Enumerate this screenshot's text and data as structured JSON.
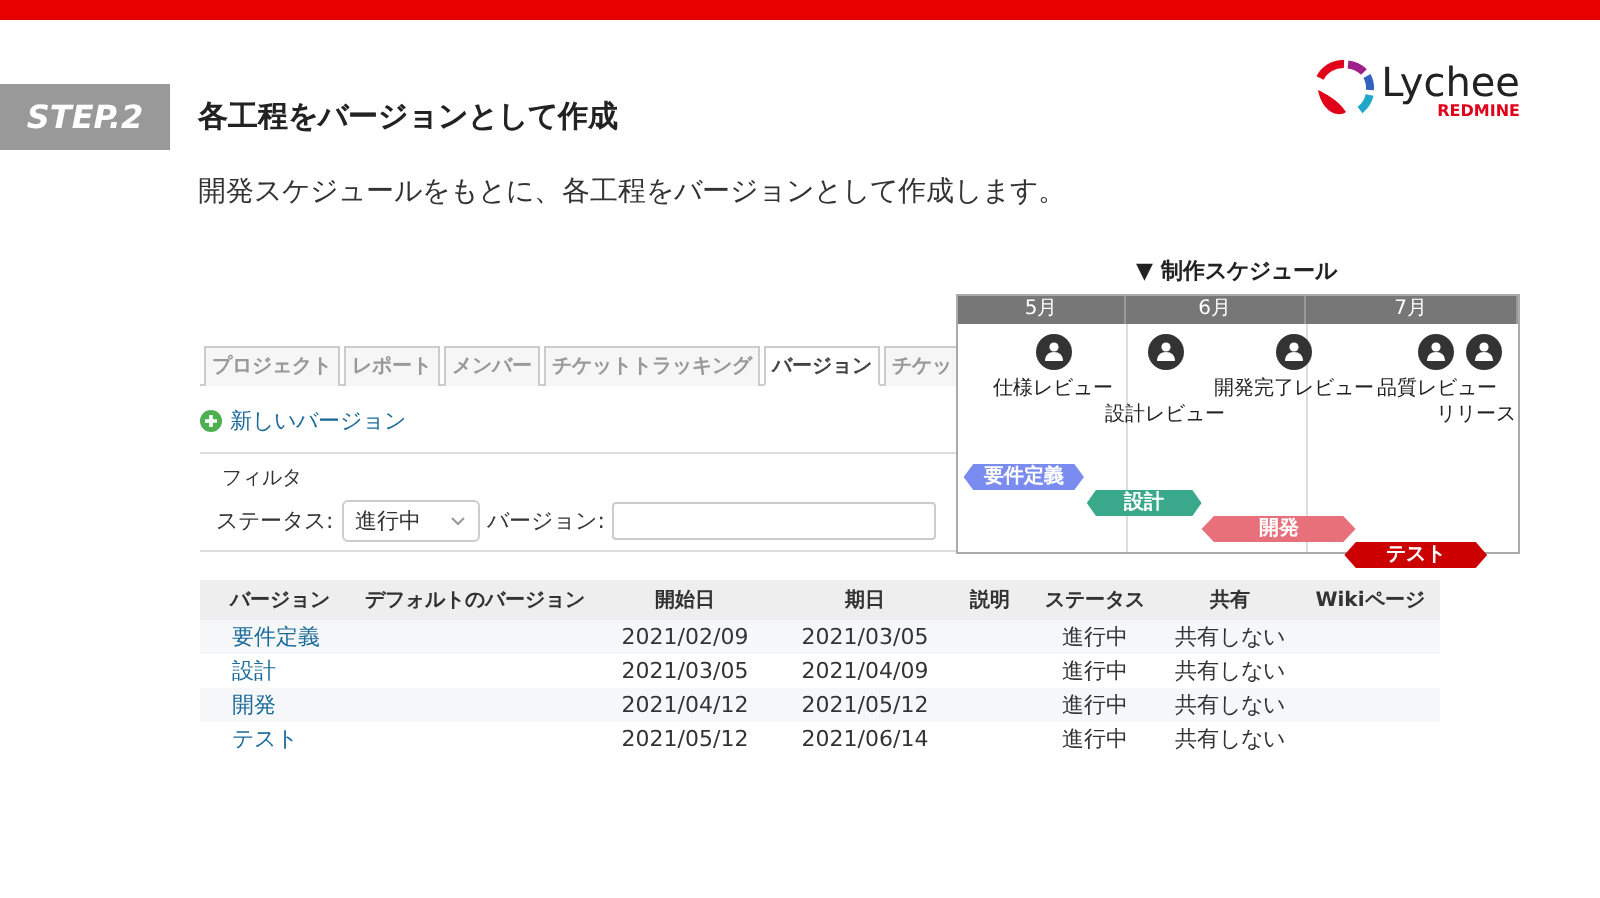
{
  "header": {
    "step": "STEP.2",
    "title": "各工程をバージョンとして作成",
    "subtitle": "開発スケジュールをもとに、各工程をバージョンとして作成します。"
  },
  "logo": {
    "name": "Lychee",
    "product": "REDMINE"
  },
  "redmine": {
    "tabs": [
      {
        "label": "プロジェクト",
        "selected": false
      },
      {
        "label": "レポート",
        "selected": false
      },
      {
        "label": "メンバー",
        "selected": false
      },
      {
        "label": "チケットトラッキング",
        "selected": false
      },
      {
        "label": "バージョン",
        "selected": true
      },
      {
        "label": "チケッ",
        "selected": false
      }
    ],
    "new_version": "新しいバージョン",
    "filter": {
      "legend": "フィルタ",
      "status_label": "ステータス:",
      "status_value": "進行中",
      "version_label": "バージョン:"
    },
    "table": {
      "columns": [
        "バージョン",
        "デフォルトのバージョン",
        "開始日",
        "期日",
        "説明",
        "ステータス",
        "共有",
        "Wikiページ"
      ],
      "rows": [
        {
          "version": "要件定義",
          "start": "2021/02/09",
          "due": "2021/03/05",
          "status": "進行中",
          "sharing": "共有しない"
        },
        {
          "version": "設計",
          "start": "2021/03/05",
          "due": "2021/04/09",
          "status": "進行中",
          "sharing": "共有しない"
        },
        {
          "version": "開発",
          "start": "2021/04/12",
          "due": "2021/05/12",
          "status": "進行中",
          "sharing": "共有しない"
        },
        {
          "version": "テスト",
          "start": "2021/05/12",
          "due": "2021/06/14",
          "status": "進行中",
          "sharing": "共有しない"
        }
      ]
    }
  },
  "schedule": {
    "title": "▼ 制作スケジュール",
    "months": [
      "5月",
      "6月",
      "7月"
    ],
    "milestones": [
      {
        "label": "仕様レビュー"
      },
      {
        "label": "設計レビュー"
      },
      {
        "label": "開発完了レビュー"
      },
      {
        "label": "品質レビュー"
      },
      {
        "label": "リリース"
      }
    ],
    "phases": [
      {
        "label": "要件定義",
        "color": "#7b8cf0"
      },
      {
        "label": "設計",
        "color": "#3aa88a"
      },
      {
        "label": "開発",
        "color": "#e8707a"
      },
      {
        "label": "テスト",
        "color": "#cc0000"
      }
    ]
  }
}
